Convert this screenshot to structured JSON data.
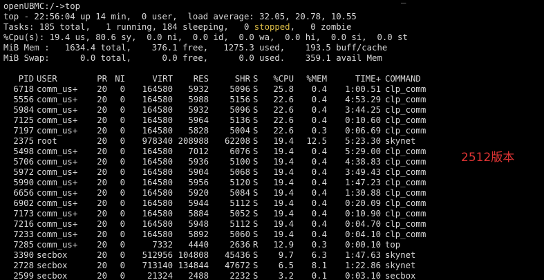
{
  "prompt_line": "openUBMC:/->top",
  "cursor_char": "_",
  "summary": {
    "line1": "top - 22:56:04 up 14 min,  0 user,  load average: 32.05, 20.78, 10.55",
    "tasks_prefix": "Tasks: 185 total,   1 running, 184 sleeping,   0 ",
    "tasks_stopped": "stopped",
    "tasks_suffix": ",   0 zombie",
    "cpu": "%Cpu(s): 19.4 us, 80.6 sy,  0.0 ni,  0.0 id,  0.0 wa,  0.0 hi,  0.0 si,  0.0 st",
    "mem": "MiB Mem :   1634.4 total,    376.1 free,   1275.3 used,    193.5 buff/cache",
    "swap": "MiB Swap:      0.0 total,      0.0 free,      0.0 used.    359.1 avail Mem"
  },
  "columns": [
    "PID",
    "USER",
    "PR",
    "NI",
    "VIRT",
    "RES",
    "SHR",
    "S",
    "%CPU",
    "%MEM",
    "TIME+",
    "COMMAND"
  ],
  "processes": [
    [
      "6718",
      "comm_us+",
      "20",
      "0",
      "164580",
      "5932",
      "5096",
      "S",
      "25.8",
      "0.4",
      "1:00.51",
      "clp_comm"
    ],
    [
      "5556",
      "comm_us+",
      "20",
      "0",
      "164580",
      "5988",
      "5156",
      "S",
      "22.6",
      "0.4",
      "4:53.29",
      "clp_comm"
    ],
    [
      "5984",
      "comm_us+",
      "20",
      "0",
      "164580",
      "5932",
      "5096",
      "S",
      "22.6",
      "0.4",
      "3:44.25",
      "clp_comm"
    ],
    [
      "7125",
      "comm_us+",
      "20",
      "0",
      "164580",
      "5964",
      "5136",
      "S",
      "22.6",
      "0.4",
      "0:10.60",
      "clp_comm"
    ],
    [
      "7197",
      "comm_us+",
      "20",
      "0",
      "164580",
      "5828",
      "5004",
      "S",
      "22.6",
      "0.3",
      "0:06.69",
      "clp_comm"
    ],
    [
      "2375",
      "root",
      "20",
      "0",
      "978340",
      "208988",
      "62208",
      "S",
      "19.4",
      "12.5",
      "5:23.30",
      "skynet"
    ],
    [
      "5498",
      "comm_us+",
      "20",
      "0",
      "164580",
      "7012",
      "6076",
      "S",
      "19.4",
      "0.4",
      "5:29.00",
      "clp_comm"
    ],
    [
      "5706",
      "comm_us+",
      "20",
      "0",
      "164580",
      "5936",
      "5100",
      "S",
      "19.4",
      "0.4",
      "4:38.83",
      "clp_comm"
    ],
    [
      "5972",
      "comm_us+",
      "20",
      "0",
      "164580",
      "5904",
      "5068",
      "S",
      "19.4",
      "0.4",
      "3:49.43",
      "clp_comm"
    ],
    [
      "5990",
      "comm_us+",
      "20",
      "0",
      "164580",
      "5956",
      "5120",
      "S",
      "19.4",
      "0.4",
      "1:47.23",
      "clp_comm"
    ],
    [
      "6656",
      "comm_us+",
      "20",
      "0",
      "164580",
      "5920",
      "5084",
      "S",
      "19.4",
      "0.4",
      "1:30.88",
      "clp_comm"
    ],
    [
      "6902",
      "comm_us+",
      "20",
      "0",
      "164580",
      "5944",
      "5112",
      "S",
      "19.4",
      "0.4",
      "0:20.09",
      "clp_comm"
    ],
    [
      "7173",
      "comm_us+",
      "20",
      "0",
      "164580",
      "5884",
      "5052",
      "S",
      "19.4",
      "0.4",
      "0:10.90",
      "clp_comm"
    ],
    [
      "7216",
      "comm_us+",
      "20",
      "0",
      "164580",
      "5948",
      "5112",
      "S",
      "19.4",
      "0.4",
      "0:04.70",
      "clp_comm"
    ],
    [
      "7233",
      "comm_us+",
      "20",
      "0",
      "164580",
      "5892",
      "5060",
      "S",
      "19.4",
      "0.4",
      "0:04.10",
      "clp_comm"
    ],
    [
      "7285",
      "comm_us+",
      "20",
      "0",
      "7332",
      "4440",
      "2636",
      "R",
      "12.9",
      "0.3",
      "0:00.10",
      "top"
    ],
    [
      "3390",
      "secbox",
      "20",
      "0",
      "512956",
      "104808",
      "45436",
      "S",
      "9.7",
      "6.3",
      "1:47.63",
      "skynet"
    ],
    [
      "2728",
      "secbox",
      "20",
      "0",
      "713140",
      "134844",
      "47672",
      "S",
      "6.5",
      "8.1",
      "1:22.86",
      "skynet"
    ],
    [
      "2599",
      "secbox",
      "20",
      "0",
      "21324",
      "2488",
      "2232",
      "S",
      "3.2",
      "0.1",
      "0:03.10",
      "secbox"
    ]
  ],
  "annotation": "2512版本",
  "colors": {
    "background": "#000000",
    "text": "#d8d8d8",
    "stopped": "#e0c048",
    "annotation": "#e03434"
  }
}
